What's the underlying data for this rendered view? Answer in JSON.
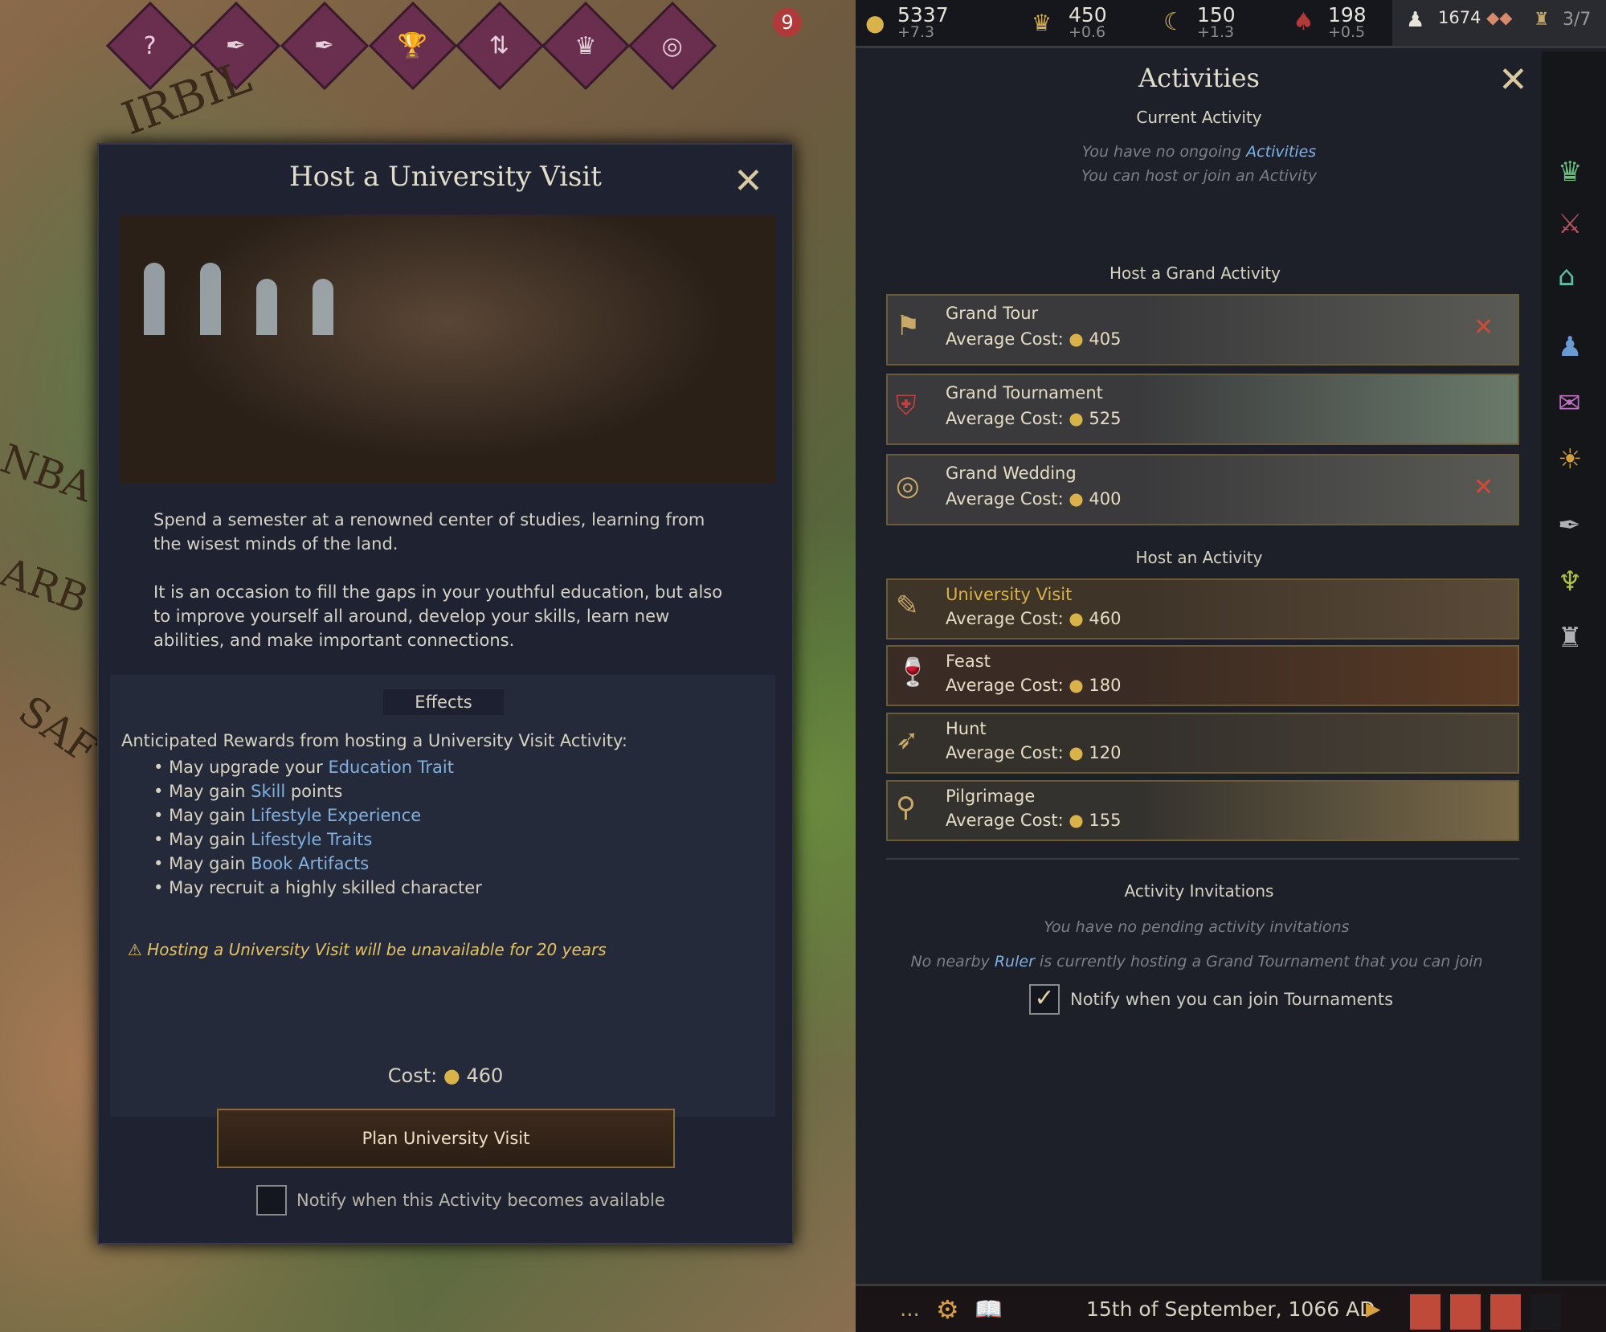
{
  "map": {
    "lens_badge": "9",
    "labels": [
      "IRBIL",
      "NBA",
      "SAF",
      "ARB"
    ]
  },
  "host_panel": {
    "title": "Host a University Visit",
    "description": [
      "Spend a semester at a renowned center of studies, learning from the wisest minds of the land.",
      "It is an occasion to fill the gaps in your youthful education, but also to improve yourself all around, develop your skills, learn new abilities, and make important connections."
    ],
    "effects_heading": "Effects",
    "rewards_intro": "Anticipated Rewards from hosting a University Visit Activity:",
    "rewards": [
      {
        "pre": "May upgrade your ",
        "hl": "Education Trait"
      },
      {
        "pre": "May gain ",
        "hl": "Skill",
        "post": " points"
      },
      {
        "pre": "May gain ",
        "hl": "Lifestyle Experience"
      },
      {
        "pre": "May gain ",
        "hl": "Lifestyle Traits"
      },
      {
        "pre": "May gain ",
        "hl": "Book Artifacts"
      },
      {
        "pre": "May recruit a highly skilled character"
      }
    ],
    "warning": "Hosting a University Visit will be unavailable for 20 years",
    "cost_label": "Cost:",
    "cost_value": "460",
    "plan_button": "Plan University Visit",
    "notify_label": "Notify when this Activity becomes available",
    "notify_checked": false
  },
  "topbar": {
    "resources": [
      {
        "icon": "gold-icon",
        "value": "5337",
        "delta": "+7.3"
      },
      {
        "icon": "prestige-crown-icon",
        "value": "450",
        "delta": "+0.6"
      },
      {
        "icon": "piety-crescent-icon",
        "value": "150",
        "delta": "+1.3"
      },
      {
        "icon": "dread-icon",
        "value": "198",
        "delta": "+0.5"
      }
    ],
    "soldiers": "1674",
    "domain": "3/7"
  },
  "activities": {
    "title": "Activities",
    "current_heading": "Current Activity",
    "no_ongoing_pre": "You have no ongoing ",
    "no_ongoing_link": "Activities",
    "can_host": "You can host or join an Activity",
    "grand_heading": "Host a Grand Activity",
    "cost_label": "Average Cost:",
    "grand": [
      {
        "name": "Grand Tour",
        "cost": "405",
        "icon": "flag-icon",
        "unavailable": true
      },
      {
        "name": "Grand Tournament",
        "cost": "525",
        "icon": "shield-icon",
        "unavailable": false
      },
      {
        "name": "Grand Wedding",
        "cost": "400",
        "icon": "rings-icon",
        "unavailable": true
      }
    ],
    "host_heading": "Host an Activity",
    "regular": [
      {
        "name": "University Visit",
        "cost": "460",
        "icon": "book-quill-icon"
      },
      {
        "name": "Feast",
        "cost": "180",
        "icon": "goblet-icon"
      },
      {
        "name": "Hunt",
        "cost": "120",
        "icon": "bow-icon"
      },
      {
        "name": "Pilgrimage",
        "cost": "155",
        "icon": "pilgrim-staff-icon"
      }
    ],
    "invites_heading": "Activity Invitations",
    "no_invites": "You have no pending activity invitations",
    "no_ruler_pre": "No nearby ",
    "no_ruler_link": "Ruler",
    "no_ruler_post": " is currently hosting a Grand Tournament that you can join",
    "notify_label": "Notify when you can join Tournaments",
    "notify_checked": true
  },
  "bottombar": {
    "date": "15th of September, 1066 AD",
    "more": "..."
  },
  "colors": {
    "accent_gold": "#d9b24a",
    "link_blue": "#7fb0e0",
    "warning": "#e4c264",
    "unavailable_red": "#d04a3a"
  }
}
